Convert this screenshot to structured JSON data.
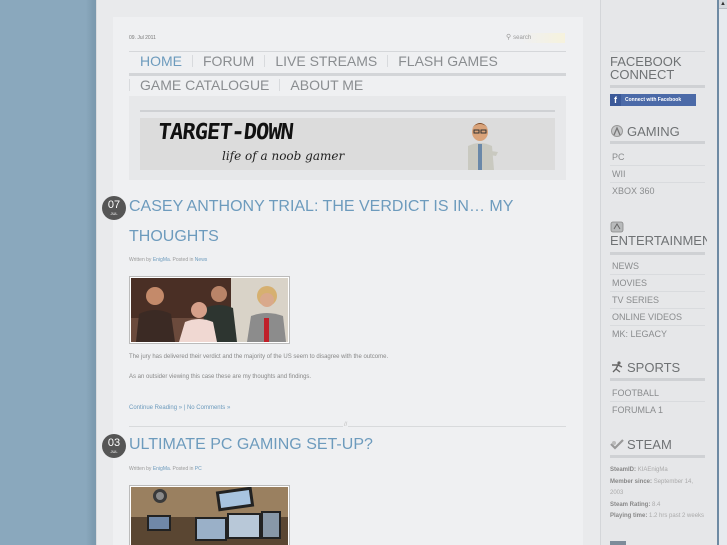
{
  "header": {
    "date": "09. Jul 2011",
    "search_placeholder": "search"
  },
  "nav": {
    "row1": [
      {
        "label": "HOME",
        "active": true
      },
      {
        "label": "FORUM",
        "active": false
      },
      {
        "label": "LIVE STREAMS",
        "active": false
      },
      {
        "label": "FLASH GAMES",
        "active": false
      }
    ],
    "row2": [
      {
        "label": "GAME CATALOGUE",
        "active": false
      },
      {
        "label": "ABOUT ME",
        "active": false
      }
    ]
  },
  "banner": {
    "logo": "TARGET-DOWN",
    "tagline": "life of a noob gamer"
  },
  "posts": [
    {
      "day": "07",
      "month": "JUL",
      "title": "CASEY ANTHONY TRIAL: THE VERDICT IS IN… MY THOUGHTS",
      "written_by_label": "Written by",
      "author": "EnigMa",
      "posted_in_label": ". Posted in",
      "category": "News",
      "image_alt": "courtroom photo",
      "paragraphs": [
        "The jury has delivered their verdict and the majority of the US seem to disagree with the outcome.",
        "As an outsider viewing this case these are my thoughts and findings."
      ],
      "continue_label": "Continue Reading »",
      "separator": " | ",
      "comments_label": "No Comments »"
    },
    {
      "day": "03",
      "month": "JUL",
      "title": "ULTIMATE PC GAMING SET-UP?",
      "written_by_label": "Written by",
      "author": "EnigMa",
      "posted_in_label": ". Posted in",
      "category": "PC",
      "image_alt": "multi-monitor gaming setup"
    }
  ],
  "divider_mark": "//",
  "sidebar": {
    "facebook": {
      "title_line1": "FACEBOOK",
      "title_line2": "CONNECT",
      "button_label": "Connect with Facebook",
      "icon": "f"
    },
    "gaming": {
      "title": "GAMING",
      "items": [
        "PC",
        "WII",
        "XBOX 360"
      ]
    },
    "entertainment": {
      "title": "ENTERTAINMENT",
      "items": [
        "NEWS",
        "MOVIES",
        "TV SERIES",
        "ONLINE VIDEOS",
        "MK: LEGACY"
      ]
    },
    "sports": {
      "title": "SPORTS",
      "items": [
        "FOOTBALL",
        "FORUMLA 1"
      ]
    },
    "steam": {
      "title": "STEAM",
      "steamid_label": "SteamID:",
      "steamid": "KIAEnigMa",
      "member_since_label": "Member since:",
      "member_since": "September 14, 2003",
      "rating_label": "Steam Rating:",
      "rating": "8.4",
      "playing_label": "Playing time:",
      "playing": "1.2 hrs past 2 weeks"
    }
  },
  "colors": {
    "background": "#8aa8bd",
    "accent": "#6d9bbd",
    "nav_text": "#8a8d90",
    "facebook": "#4b6aa8"
  }
}
